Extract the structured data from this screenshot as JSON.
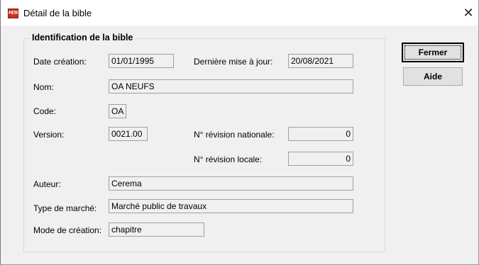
{
  "window": {
    "title": "Détail de la bible",
    "icon_text": "FETRA",
    "close_glyph": "✕"
  },
  "group": {
    "title": "Identification de la bible"
  },
  "fields": {
    "date_creation": {
      "label": "Date création:",
      "value": "01/01/1995"
    },
    "derniere_maj": {
      "label": "Dernière mise à jour:",
      "value": "20/08/2021"
    },
    "nom": {
      "label": "Nom:",
      "value": "OA NEUFS"
    },
    "code": {
      "label": "Code:",
      "value": "OA"
    },
    "version": {
      "label": "Version:",
      "value": "0021.00"
    },
    "revision_nationale": {
      "label": "N° révision nationale:",
      "value": "0"
    },
    "revision_locale": {
      "label": "N° révision locale:",
      "value": "0"
    },
    "auteur": {
      "label": "Auteur:",
      "value": "Cerema"
    },
    "type_marche": {
      "label": "Type de marché:",
      "value": "Marché public de travaux"
    },
    "mode_creation": {
      "label": "Mode de création:",
      "value": "chapitre"
    }
  },
  "buttons": {
    "fermer": "Fermer",
    "aide": "Aide"
  }
}
